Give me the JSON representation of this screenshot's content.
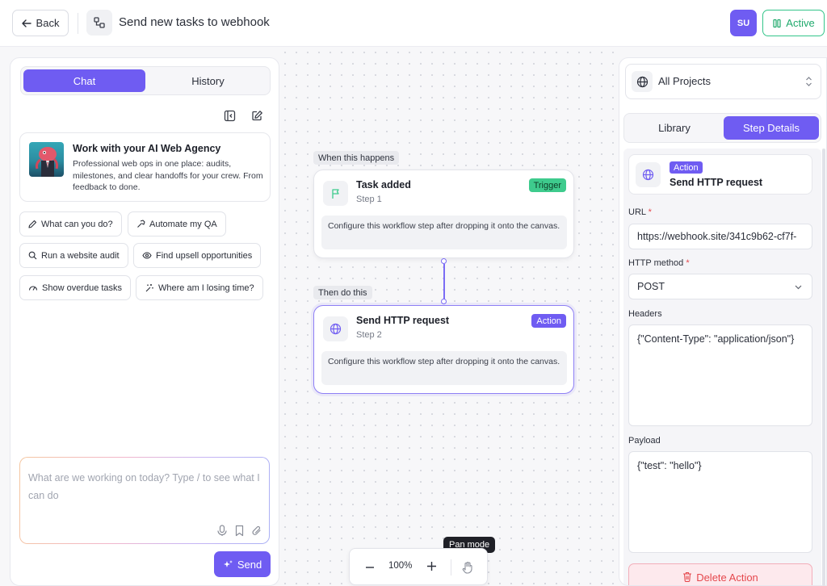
{
  "header": {
    "back_label": "Back",
    "workflow_title": "Send new tasks to webhook",
    "avatar_initials": "SU",
    "status_label": "Active"
  },
  "left": {
    "tabs": {
      "chat": "Chat",
      "history": "History"
    },
    "agency": {
      "title": "Work with your AI Web Agency",
      "description": "Professional web ops in one place: audits, milestones, and clear handoffs for your crew. From feedback to done."
    },
    "suggestions": [
      "What can you do?",
      "Automate my QA",
      "Run a website audit",
      "Find upsell opportunities",
      "Show overdue tasks",
      "Where am I losing time?"
    ],
    "input_placeholder": "What are we working on today? Type / to see what I can do",
    "send_label": "Send"
  },
  "canvas": {
    "stage1_label": "When this happens",
    "stage2_label": "Then do this",
    "node1": {
      "title": "Task added",
      "step": "Step 1",
      "badge": "Trigger",
      "description": "Configure this workflow step after dropping it onto the canvas."
    },
    "node2": {
      "title": "Send HTTP request",
      "step": "Step 2",
      "badge": "Action",
      "description": "Configure this workflow step after dropping it onto the canvas."
    },
    "zoom_value": "100%",
    "tooltip": "Pan mode"
  },
  "right": {
    "project_select": "All Projects",
    "tabs": {
      "library": "Library",
      "details": "Step Details"
    },
    "action_badge": "Action",
    "action_title": "Send HTTP request",
    "url_label": "URL",
    "url_value": "https://webhook.site/341c9b62-cf7f-",
    "method_label": "HTTP method",
    "method_value": "POST",
    "headers_label": "Headers",
    "headers_value": "{\"Content-Type\": \"application/json\"}",
    "payload_label": "Payload",
    "payload_value": "{\"test\": \"hello\"}",
    "delete_label": "Delete Action",
    "required_mark": "*"
  },
  "colors": {
    "accent": "#6f5cf2",
    "active_green": "#1fa96c",
    "trigger_green": "#3ecb8d",
    "danger": "#e5484d"
  },
  "icons": {
    "back": "arrow-left-icon",
    "workflow": "workflow-icon",
    "status": "pause-icon",
    "collapse": "sidebar-collapse-icon",
    "new_chat": "edit-icon",
    "trigger": "flag-icon",
    "action": "globe-icon",
    "pan": "hand-icon",
    "delete": "trash-icon"
  }
}
